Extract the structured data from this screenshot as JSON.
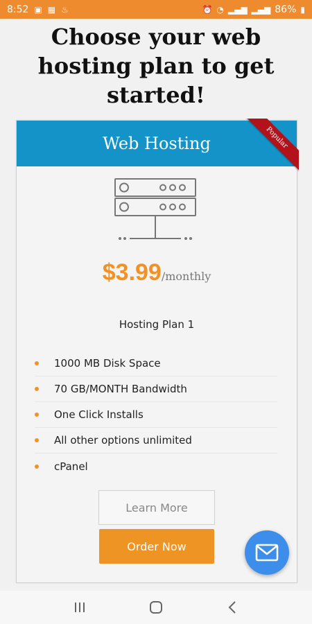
{
  "status_bar": {
    "time": "8:52",
    "battery": "86%",
    "left_icons": [
      "messages-icon",
      "image-icon",
      "notification-icon"
    ],
    "right_icons": [
      "alarm-icon",
      "wifi-icon",
      "signal-icon",
      "signal-icon",
      "battery-icon"
    ]
  },
  "page": {
    "title": "Choose your web hosting plan to get started!"
  },
  "plan": {
    "header": "Web Hosting",
    "ribbon": "Popular",
    "price_amount": "$3.99",
    "price_period": "/monthly",
    "name": "Hosting Plan 1",
    "features": [
      "1000 MB Disk Space",
      "70 GB/MONTH Bandwidth",
      "One Click Installs",
      "All other options unlimited",
      "cPanel"
    ],
    "learn_more_label": "Learn More",
    "order_label": "Order Now"
  },
  "fab": {
    "icon": "mail-icon"
  },
  "nav_bar": {
    "icons": [
      "recent-apps-icon",
      "home-icon",
      "back-icon"
    ]
  },
  "colors": {
    "status_bar": "#ee8b2f",
    "header": "#1493c8",
    "accent": "#f39224",
    "ribbon": "#b3121a",
    "fab": "#3d8eea"
  }
}
